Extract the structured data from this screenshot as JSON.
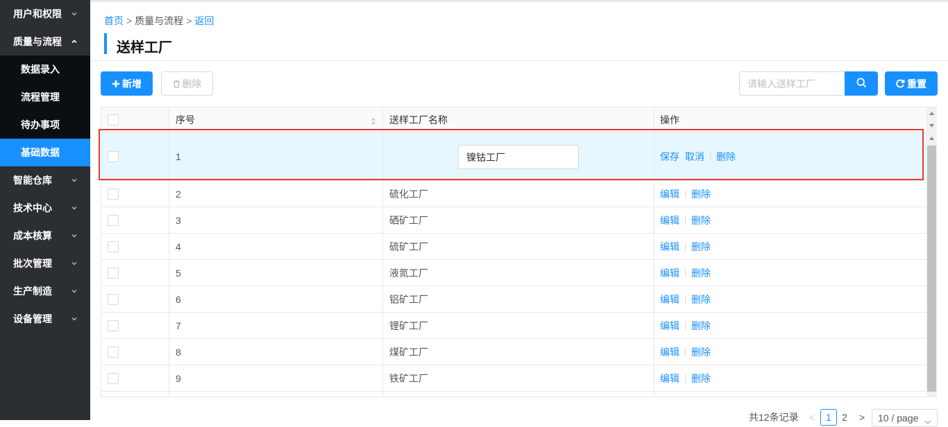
{
  "sidebar": {
    "items": [
      {
        "label": "用户和权限",
        "expanded": false
      },
      {
        "label": "质量与流程",
        "expanded": true,
        "children": [
          {
            "label": "数据录入"
          },
          {
            "label": "流程管理"
          },
          {
            "label": "待办事项"
          },
          {
            "label": "基础数据",
            "active": true
          }
        ]
      },
      {
        "label": "智能仓库",
        "expanded": false
      },
      {
        "label": "技术中心",
        "expanded": false
      },
      {
        "label": "成本核算",
        "expanded": false
      },
      {
        "label": "批次管理",
        "expanded": false
      },
      {
        "label": "生产制造",
        "expanded": false
      },
      {
        "label": "设备管理",
        "expanded": false
      }
    ]
  },
  "breadcrumb": {
    "home": "首页",
    "sep": ">",
    "current": "质量与流程",
    "back": "返回"
  },
  "page_title": "送样工厂",
  "toolbar": {
    "add_label": "新增",
    "delete_label": "删除",
    "search_placeholder": "请输入送样工厂",
    "reset_label": "重置"
  },
  "table": {
    "headers": {
      "index": "序号",
      "name": "送样工厂名称",
      "ops": "操作"
    },
    "editing_row": {
      "index": "1",
      "name_value": "镍钴工厂",
      "save": "保存",
      "cancel": "取消",
      "delete": "删除"
    },
    "rows": [
      {
        "index": "2",
        "name": "硫化工厂"
      },
      {
        "index": "3",
        "name": "硒矿工厂"
      },
      {
        "index": "4",
        "name": "硫矿工厂"
      },
      {
        "index": "5",
        "name": "液氮工厂"
      },
      {
        "index": "6",
        "name": "铝矿工厂"
      },
      {
        "index": "7",
        "name": "锂矿工厂"
      },
      {
        "index": "8",
        "name": "煤矿工厂"
      },
      {
        "index": "9",
        "name": "铁矿工厂"
      }
    ],
    "row_ops": {
      "edit": "编辑",
      "delete": "删除"
    }
  },
  "pagination": {
    "total": "共12条记录",
    "prev": "<",
    "pages": [
      "1",
      "2"
    ],
    "current_page": "1",
    "next": ">",
    "page_size": "10 / page"
  },
  "colors": {
    "accent": "#1890ff",
    "sidebar_bg": "#2b2f33",
    "highlight": "#e53935",
    "editing_row_bg": "#e6f7ff"
  }
}
